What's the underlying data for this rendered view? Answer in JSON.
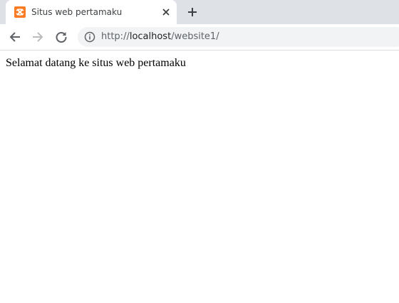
{
  "tab": {
    "title": "Situs web pertamaku",
    "favicon": "xampp-logo-icon",
    "favicon_color": "#fb7a24"
  },
  "toolbar": {
    "back_icon": "arrow-left-icon",
    "forward_icon": "arrow-right-icon",
    "reload_icon": "reload-icon",
    "info_icon": "info-icon",
    "url_scheme": "http://",
    "url_host": "localhost",
    "url_path": "/website1/"
  },
  "page": {
    "text": "Selamat datang ke situs web pertamaku"
  }
}
